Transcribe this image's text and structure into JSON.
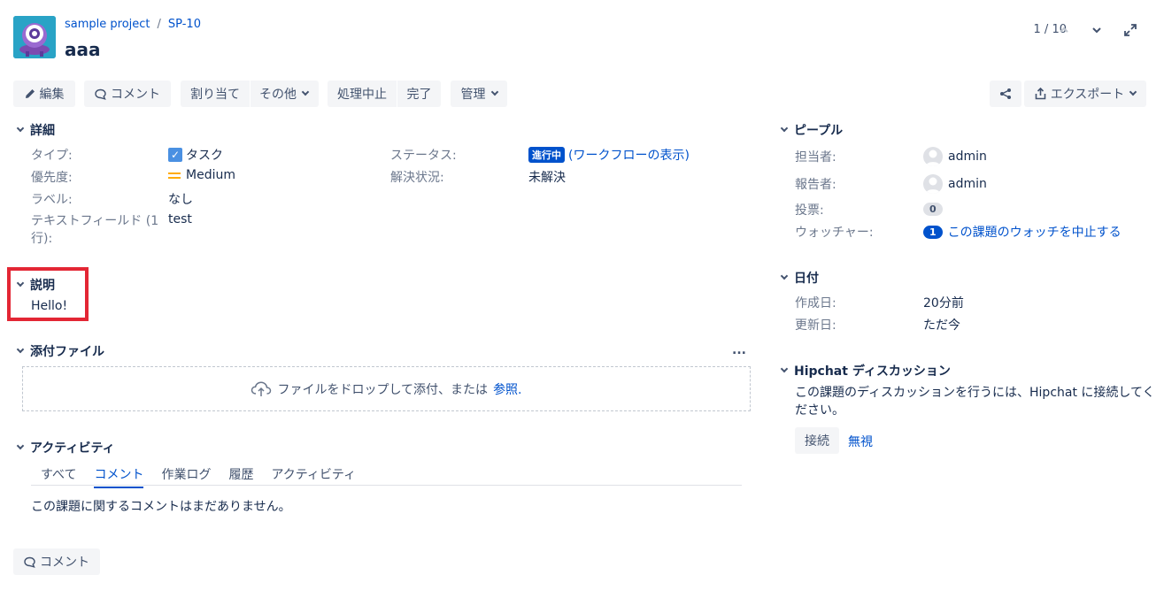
{
  "header": {
    "project": "sample project",
    "separator": "/",
    "issue_key": "SP-10",
    "title": "aaa",
    "pager": "1 / 10"
  },
  "toolbar": {
    "edit": "編集",
    "comment": "コメント",
    "assign": "割り当て",
    "more": "その他",
    "stop_progress": "処理中止",
    "done": "完了",
    "admin": "管理",
    "export": "エクスポート"
  },
  "details": {
    "heading": "詳細",
    "type_label": "タイプ:",
    "type_value": "タスク",
    "priority_label": "優先度:",
    "priority_value": "Medium",
    "labels_label": "ラベル:",
    "labels_value": "なし",
    "textfield_label": "テキストフィールド (1行):",
    "textfield_value": "test",
    "status_label": "ステータス:",
    "status_value": "進行中",
    "workflow_link": "(ワークフローの表示)",
    "resolution_label": "解決状況:",
    "resolution_value": "未解決"
  },
  "description": {
    "heading": "説明",
    "text": "Hello!",
    "highlight_color": "#e32634"
  },
  "attachments": {
    "heading": "添付ファイル",
    "more": "...",
    "drop_text": "ファイルをドロップして添付、または",
    "browse_link": "参照."
  },
  "activity": {
    "heading": "アクティビティ",
    "tabs": [
      "すべて",
      "コメント",
      "作業ログ",
      "履歴",
      "アクティビティ"
    ],
    "active_tab": 1,
    "empty_text": "この課題に関するコメントはまだありません。",
    "comment_button": "コメント"
  },
  "people": {
    "heading": "ピープル",
    "assignee_label": "担当者:",
    "assignee": "admin",
    "reporter_label": "報告者:",
    "reporter": "admin",
    "votes_label": "投票:",
    "votes": "0",
    "watchers_label": "ウォッチャー:",
    "watchers": "1",
    "watch_link": "この課題のウォッチを中止する"
  },
  "dates": {
    "heading": "日付",
    "created_label": "作成日:",
    "created": "20分前",
    "updated_label": "更新日:",
    "updated": "ただ今"
  },
  "hipchat": {
    "heading": "Hipchat ディスカッション",
    "text": "この課題のディスカッションを行うには、Hipchat に接続してください。",
    "connect": "接続",
    "ignore": "無視"
  }
}
